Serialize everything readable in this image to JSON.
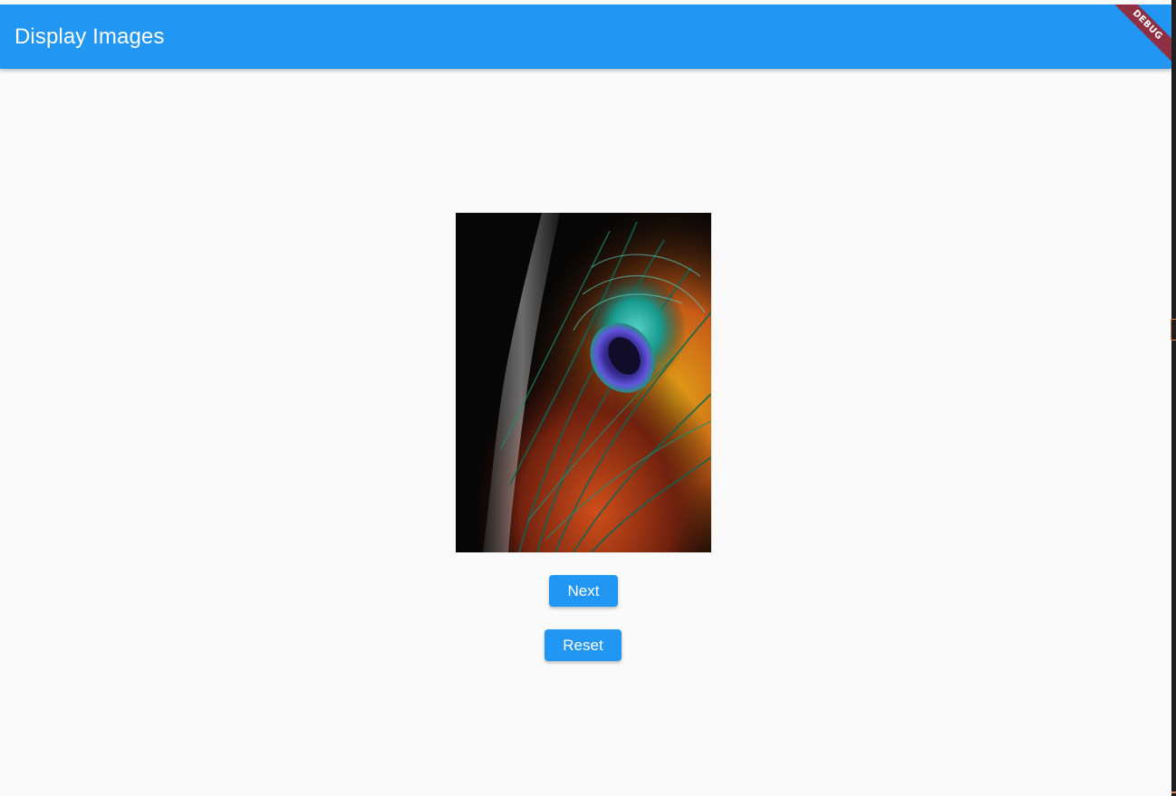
{
  "appbar": {
    "title": "Display Images",
    "color": "#2196f3"
  },
  "debug_banner": {
    "label": "DEBUG",
    "color": "#8e2f43"
  },
  "main": {
    "image": {
      "subject": "peacock-feather-photo"
    },
    "buttons": {
      "next_label": "Next",
      "reset_label": "Reset",
      "color": "#2196f3"
    }
  },
  "colors": {
    "background": "#fafafa"
  }
}
